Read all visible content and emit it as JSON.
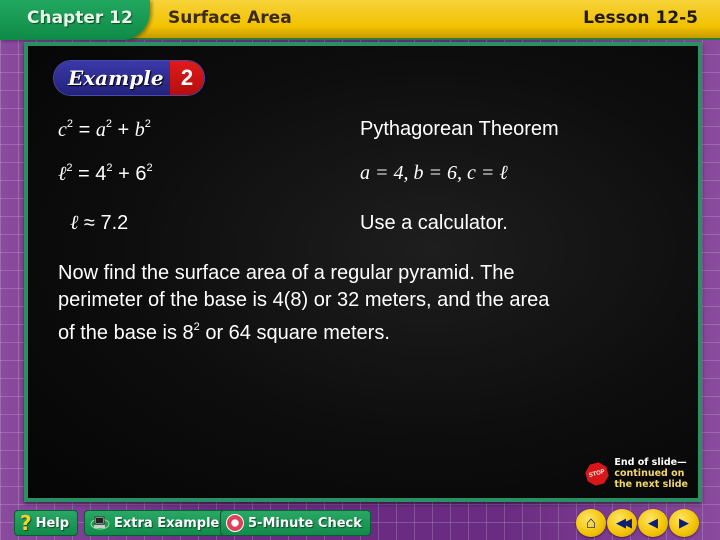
{
  "header": {
    "chapter": "Chapter 12",
    "topic": "Surface Area",
    "lesson": "Lesson 12-5"
  },
  "example": {
    "label": "Example",
    "number": "2"
  },
  "steps": [
    {
      "equation": {
        "lhs": "c",
        "lhs_exp": "2",
        "op": "=",
        "t1": "a",
        "t1_exp": "2",
        "plus": "+",
        "t2": "b",
        "t2_exp": "2"
      },
      "note": "Pythagorean Theorem"
    },
    {
      "equation": {
        "lhs": "ℓ",
        "lhs_exp": "2",
        "op": "=",
        "t1": "4",
        "t1_exp": "2",
        "plus": "+",
        "t2": "6",
        "t2_exp": "2"
      },
      "note": "a = 4, b = 6, c = ℓ"
    },
    {
      "equation": {
        "lhs": "ℓ",
        "op": "≈",
        "value": "7.2"
      },
      "note": "Use a calculator."
    }
  ],
  "paragraph": {
    "line1": "Now find the surface area of a regular pyramid. The",
    "line2_a": "perimeter of the base is ",
    "line2_b": "4(8)",
    "line2_c": " or 32 meters, and the area",
    "line3_a": "of the base is ",
    "line3_base": "8",
    "line3_exp": "2",
    "line3_c": " or 64 square meters."
  },
  "end_of_slide": {
    "stop_label": "STOP",
    "line1": "End of slide—",
    "line2": "continued on",
    "line3": "the next slide"
  },
  "footer": {
    "help": "Help",
    "extra_examples": "Extra Examples",
    "five_minute_check": "5-Minute Check",
    "nav": {
      "home_icon": "⌂",
      "first_icon": "◀◀",
      "prev_icon": "◀",
      "next_icon": "▶"
    }
  },
  "colors": {
    "header_yellow": "#f2c200",
    "chapter_green": "#0e8a47",
    "board_border": "#2a8f62",
    "background_purple": "#6a2c82",
    "example_blue": "#23227c",
    "example_red": "#b40f0f"
  }
}
